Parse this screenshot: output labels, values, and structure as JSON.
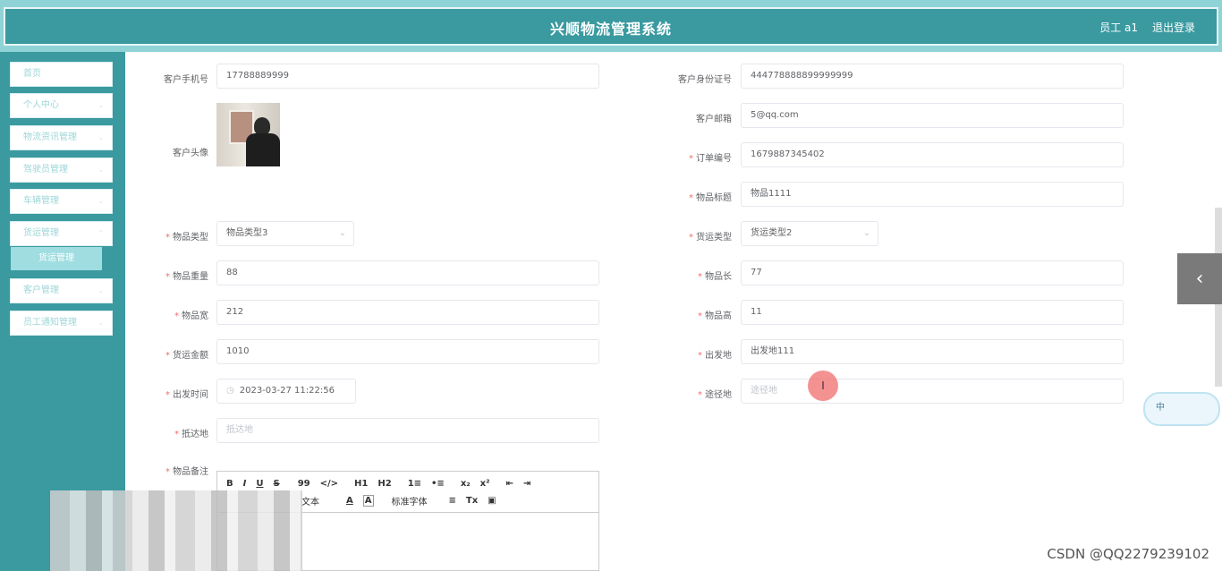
{
  "header": {
    "title": "兴顺物流管理系统",
    "user": "员工 a1",
    "logout": "退出登录"
  },
  "sidebar": {
    "items": [
      "首页",
      "个人中心",
      "物流资讯管理",
      "驾驶员管理",
      "车辆管理",
      "货运管理",
      "客户管理",
      "员工通知管理"
    ],
    "submenu": "货运管理"
  },
  "form": {
    "customer_phone": {
      "label": "客户手机号",
      "value": "17788889999"
    },
    "customer_id": {
      "label": "客户身份证号",
      "value": "444778888899999999"
    },
    "avatar": {
      "label": "客户头像"
    },
    "customer_email": {
      "label": "客户邮箱",
      "value": "5@qq.com"
    },
    "order_no": {
      "label": "订单编号",
      "value": "1679887345402"
    },
    "item_title": {
      "label": "物品标题",
      "value": "物品1111"
    },
    "item_type": {
      "label": "物品类型",
      "value": "物品类型3"
    },
    "freight_type": {
      "label": "货运类型",
      "value": "货运类型2"
    },
    "item_weight": {
      "label": "物品重量",
      "value": "88"
    },
    "item_length": {
      "label": "物品长",
      "value": "77"
    },
    "item_width": {
      "label": "物品宽",
      "value": "212"
    },
    "item_height": {
      "label": "物品高",
      "value": "11"
    },
    "freight_amount": {
      "label": "货运金额",
      "value": "1010"
    },
    "origin": {
      "label": "出发地",
      "value": "出发地111"
    },
    "depart_time": {
      "label": "出发时间",
      "value": "2023-03-27 11:22:56"
    },
    "via": {
      "label": "途径地",
      "placeholder": "途径地"
    },
    "destination": {
      "label": "抵达地",
      "placeholder": "抵达地"
    },
    "remark": {
      "label": "物品备注"
    }
  },
  "editor": {
    "row1": [
      "B",
      "I",
      "U",
      "S",
      "99",
      "</>",
      "H1",
      "H2",
      "1≡",
      "•≡",
      "x₂",
      "x²",
      "⇤",
      "⇥"
    ],
    "row2": [
      "文本",
      "A",
      "A",
      "标准字体",
      "≡",
      "Tx",
      "▣"
    ]
  },
  "ime": "中",
  "watermark": "CSDN @QQ2279239102"
}
